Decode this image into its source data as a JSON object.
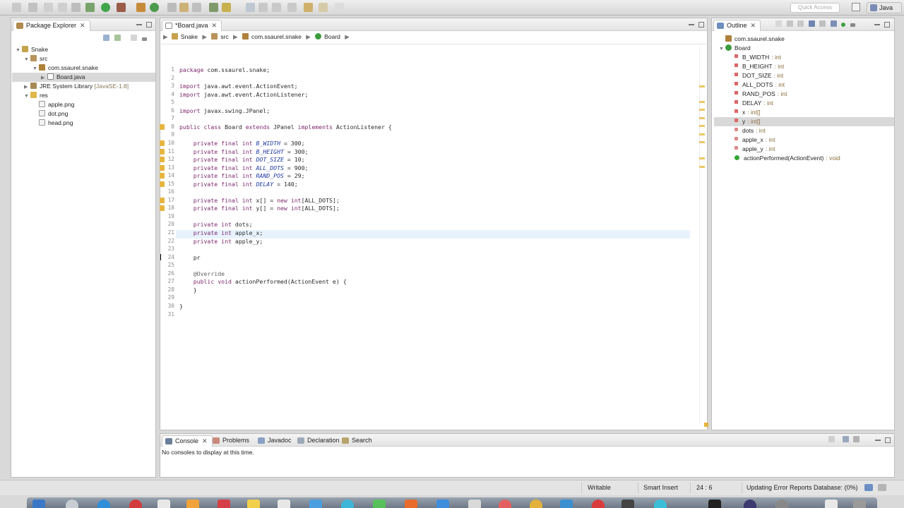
{
  "toolbar": {
    "quick_access_placeholder": "Quick Access",
    "perspective_label": "Java"
  },
  "package_explorer": {
    "tab_label": "Package Explorer",
    "tree": [
      {
        "label": "Snake",
        "icon": "project-icon",
        "extra": ""
      },
      {
        "label": "src",
        "icon": "source-folder-icon",
        "extra": ""
      },
      {
        "label": "com.ssaurel.snake",
        "icon": "package-icon",
        "extra": ""
      },
      {
        "label": "Board.java",
        "icon": "java-file-icon",
        "extra": ""
      },
      {
        "label": "JRE System Library",
        "icon": "library-icon",
        "extra": "[JavaSE-1.8]"
      },
      {
        "label": "res",
        "icon": "folder-icon",
        "extra": ""
      },
      {
        "label": "apple.png",
        "icon": "image-file-icon",
        "extra": ""
      },
      {
        "label": "dot.png",
        "icon": "image-file-icon",
        "extra": ""
      },
      {
        "label": "head.png",
        "icon": "image-file-icon",
        "extra": ""
      }
    ]
  },
  "editor": {
    "tab_label": "*Board.java",
    "breadcrumb": [
      "Snake",
      "src",
      "com.ssaurel.snake",
      "Board"
    ],
    "lines": [
      {
        "n": "1",
        "text": "package com.ssaurel.snake;"
      },
      {
        "n": "2",
        "text": ""
      },
      {
        "n": "3",
        "text": "import java.awt.event.ActionEvent;"
      },
      {
        "n": "4",
        "text": "import java.awt.event.ActionListener;"
      },
      {
        "n": "5",
        "text": ""
      },
      {
        "n": "6",
        "text": "import javax.swing.JPanel;"
      },
      {
        "n": "7",
        "text": ""
      },
      {
        "n": "8",
        "text": "public class Board extends JPanel implements ActionListener {"
      },
      {
        "n": "9",
        "text": ""
      },
      {
        "n": "10",
        "text": "    private final int B_WIDTH = 300;"
      },
      {
        "n": "11",
        "text": "    private final int B_HEIGHT = 300;"
      },
      {
        "n": "12",
        "text": "    private final int DOT_SIZE = 10;"
      },
      {
        "n": "13",
        "text": "    private final int ALL_DOTS = 900;"
      },
      {
        "n": "14",
        "text": "    private final int RAND_POS = 29;"
      },
      {
        "n": "15",
        "text": "    private final int DELAY = 140;"
      },
      {
        "n": "16",
        "text": ""
      },
      {
        "n": "17",
        "text": "    private final int x[] = new int[ALL_DOTS];"
      },
      {
        "n": "18",
        "text": "    private final int y[] = new int[ALL_DOTS];"
      },
      {
        "n": "19",
        "text": ""
      },
      {
        "n": "20",
        "text": "    private int dots;"
      },
      {
        "n": "21",
        "text": "    private int apple_x;"
      },
      {
        "n": "22",
        "text": "    private int apple_y;"
      },
      {
        "n": "23",
        "text": ""
      },
      {
        "n": "24",
        "text": "    pr"
      },
      {
        "n": "25",
        "text": ""
      },
      {
        "n": "26",
        "text": "    @Override"
      },
      {
        "n": "27",
        "text": "    public void actionPerformed(ActionEvent e) {"
      },
      {
        "n": "28",
        "text": "    }"
      },
      {
        "n": "29",
        "text": ""
      },
      {
        "n": "30",
        "text": "}"
      },
      {
        "n": "31",
        "text": ""
      }
    ]
  },
  "outline": {
    "tab_label": "Outline",
    "items": [
      {
        "label": "com.ssaurel.snake",
        "type": "",
        "kind": "package"
      },
      {
        "label": "Board",
        "type": "",
        "kind": "class"
      },
      {
        "label": "B_WIDTH",
        "type": ": int",
        "kind": "final-field"
      },
      {
        "label": "B_HEIGHT",
        "type": ": int",
        "kind": "final-field"
      },
      {
        "label": "DOT_SIZE",
        "type": ": int",
        "kind": "final-field"
      },
      {
        "label": "ALL_DOTS",
        "type": ": int",
        "kind": "final-field"
      },
      {
        "label": "RAND_POS",
        "type": ": int",
        "kind": "final-field"
      },
      {
        "label": "DELAY",
        "type": ": int",
        "kind": "final-field"
      },
      {
        "label": "x",
        "type": ": int[]",
        "kind": "final-field"
      },
      {
        "label": "y",
        "type": ": int[]",
        "kind": "final-field"
      },
      {
        "label": "dots",
        "type": ": int",
        "kind": "field"
      },
      {
        "label": "apple_x",
        "type": ": int",
        "kind": "field"
      },
      {
        "label": "apple_y",
        "type": ": int",
        "kind": "field"
      },
      {
        "label": "actionPerformed(ActionEvent)",
        "type": ": void",
        "kind": "method"
      }
    ]
  },
  "console": {
    "tabs": [
      "Console",
      "Problems",
      "Javadoc",
      "Declaration",
      "Search"
    ],
    "message": "No consoles to display at this time."
  },
  "status": {
    "writable": "Writable",
    "insert_mode": "Smart Insert",
    "position": "24 : 6",
    "progress_text": "Updating Error Reports Database: (0%)"
  },
  "colors": {
    "accent_selection": "#e8f2fe",
    "keyword": "#7d2a6e",
    "field": "#1f3aa0",
    "warning": "#e6b53f"
  }
}
